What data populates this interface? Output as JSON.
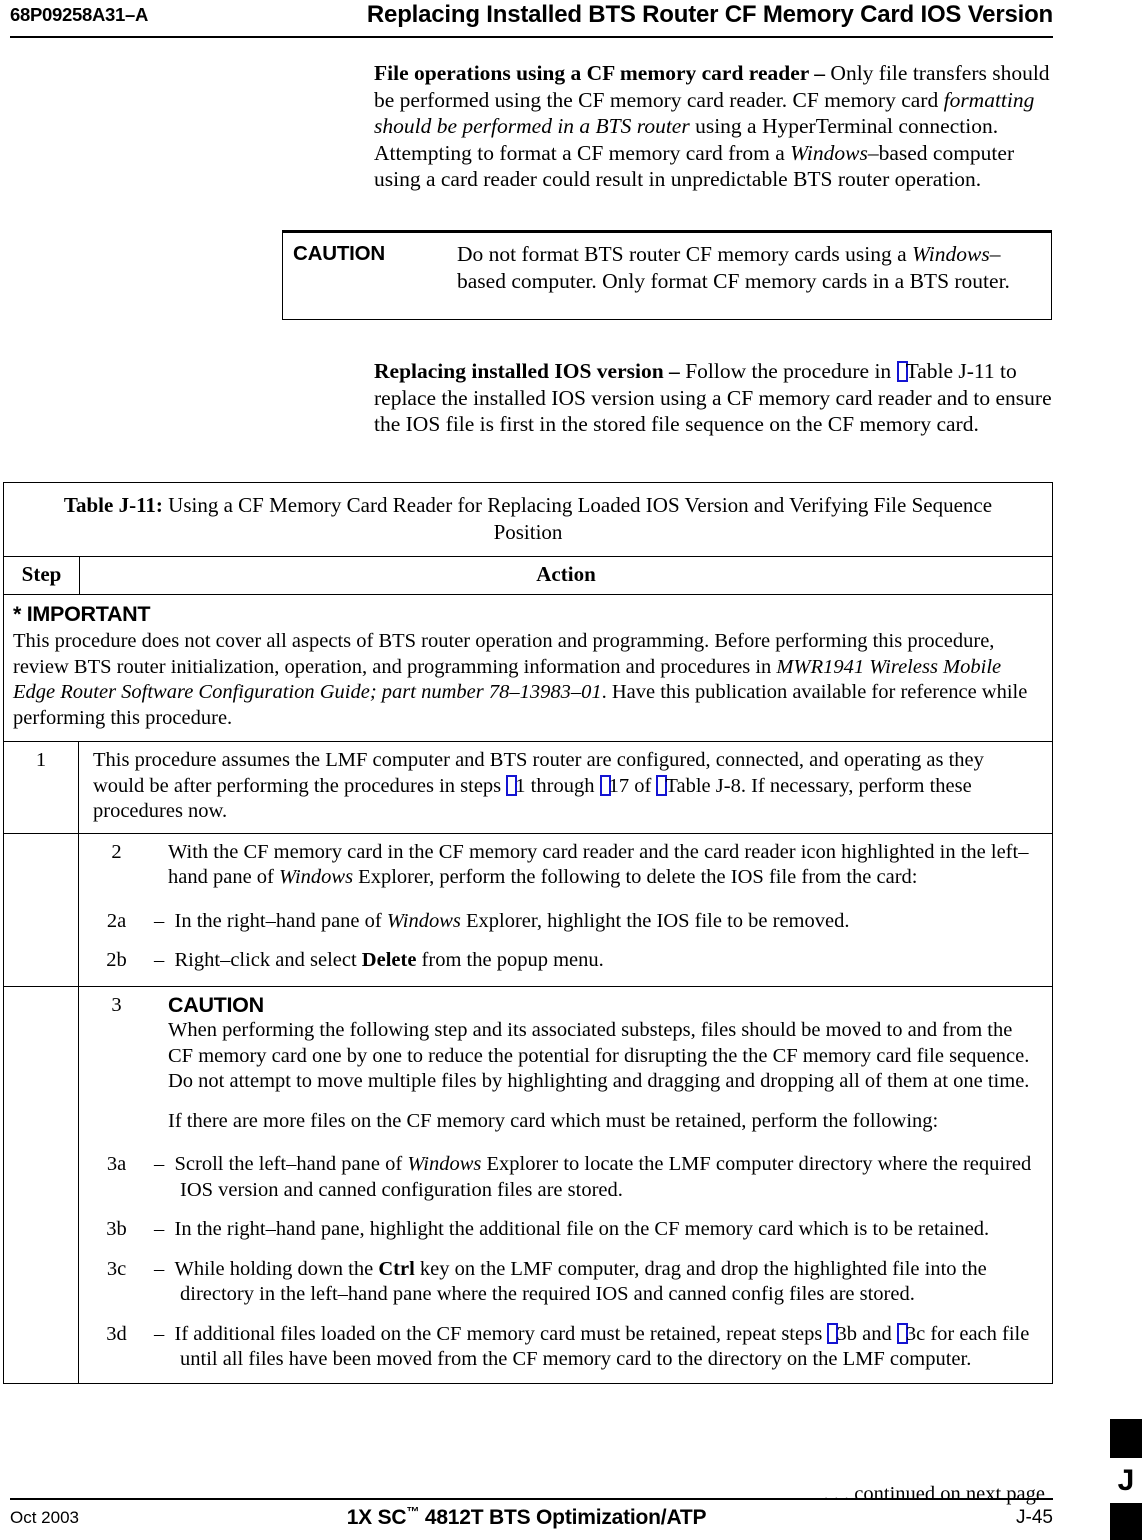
{
  "header": {
    "doc_number": "68P09258A31–A",
    "title": "Replacing Installed BTS Router CF Memory Card IOS Version"
  },
  "body": {
    "para_file_operations": {
      "lead": "File operations using a CF memory card reader – ",
      "t1": "Only file transfers should be performed using the CF memory card reader. CF memory card ",
      "em1": "formatting should be performed in a BTS router",
      "t2": " using a HyperTerminal connection. Attempting to format a CF memory card from a ",
      "em2": "Windows",
      "t3": "–based computer using a card reader could result in unpredictable BTS router operation."
    },
    "caution_box": {
      "label": "CAUTION",
      "t1": "Do not format BTS router CF memory cards using a ",
      "em1": "Windows",
      "t2": "–based computer. Only format CF memory cards in a BTS router."
    },
    "para_replacing_ios": {
      "lead": "Replacing installed IOS version – ",
      "t1": "Follow the procedure in ",
      "xref1": "Table J-11",
      "t2": " to replace the installed IOS version using a CF memory card reader and to ensure the IOS file is first in the stored file sequence on the CF memory card."
    }
  },
  "table": {
    "caption_strong": "Table J-11:",
    "caption_rest": " Using a CF Memory Card Reader for Replacing Loaded IOS Version and Verifying File Sequence Position",
    "columns": {
      "step": "Step",
      "action": "Action"
    },
    "important": {
      "title": "* IMPORTANT",
      "t1": "This procedure does not cover all aspects of BTS router operation and programming. Before performing this procedure, review BTS router initialization, operation, and programming information and procedures in ",
      "em1": "MWR1941 Wireless Mobile Edge Router Software Configuration Guide; part number 78–13983–01",
      "t2": ". Have this publication available for reference while performing this procedure."
    },
    "step1": {
      "num": "1",
      "t1": "This procedure assumes the LMF computer and BTS router are configured, connected, and operating as they would be after performing the procedures in steps ",
      "xref1": "1",
      "t2": " through ",
      "xref2": "17",
      "t3": " of ",
      "xref3": "Table J-8",
      "t4": ". If necessary, perform these procedures now."
    },
    "step2": {
      "num": "2",
      "t1": "With the CF memory card in the CF memory card reader and the card reader icon highlighted in the left–hand pane of ",
      "em1": "Windows",
      "t2": " Explorer, perform the following to delete the IOS file from the card:",
      "sub_a": {
        "num": "2a",
        "dash": "–",
        "t1": "In the right–hand pane of ",
        "em1": "Windows",
        "t2": " Explorer, highlight the IOS file to be removed."
      },
      "sub_b": {
        "num": "2b",
        "dash": "–",
        "t1": "Right–click and select ",
        "strong1": "Delete",
        "t2": " from the popup menu."
      }
    },
    "step3": {
      "num": "3",
      "caution_title": "CAUTION",
      "caution_text": "When performing the following step and its associated substeps, files should be moved to and from the CF memory card one by one to reduce the potential for disrupting the the CF memory card file sequence. Do not attempt to move multiple files by highlighting and dragging and dropping all of them at one time.",
      "intro": "If there are more files on the CF memory card which must be retained, perform the following:",
      "sub_a": {
        "num": "3a",
        "dash": "–",
        "t1": "Scroll the left–hand pane of ",
        "em1": "Windows",
        "t2": " Explorer to locate the LMF computer directory where the required IOS version and canned configuration files are stored."
      },
      "sub_b": {
        "num": "3b",
        "dash": "–",
        "t1": "In the right–hand pane, highlight the additional file on the CF memory card which is to be retained."
      },
      "sub_c": {
        "num": "3c",
        "dash": "–",
        "t1": "While holding down the ",
        "strong1": "Ctrl",
        "t2": " key on the LMF computer, drag and drop the highlighted file into the directory in the left–hand pane where the required IOS and canned config files are stored."
      },
      "sub_d": {
        "num": "3d",
        "dash": "–",
        "t1": "If additional files loaded on the CF memory card must be retained, repeat steps ",
        "xref1": "3b",
        "t2": " and ",
        "xref2": "3c",
        "t3": " for each file until all files have been moved from the CF memory card to the directory on the LMF computer."
      }
    }
  },
  "continued_note": ". . . continued on next page",
  "footer": {
    "date": "Oct 2003",
    "center_pre": "1X SC",
    "center_tm": "™",
    "center_post": " 4812T BTS Optimization/ATP",
    "page": "J-45",
    "tab_letter": "J"
  },
  "colors": {
    "ink": "#000000",
    "paper": "#ffffff",
    "xref_link": "#1414d2"
  }
}
